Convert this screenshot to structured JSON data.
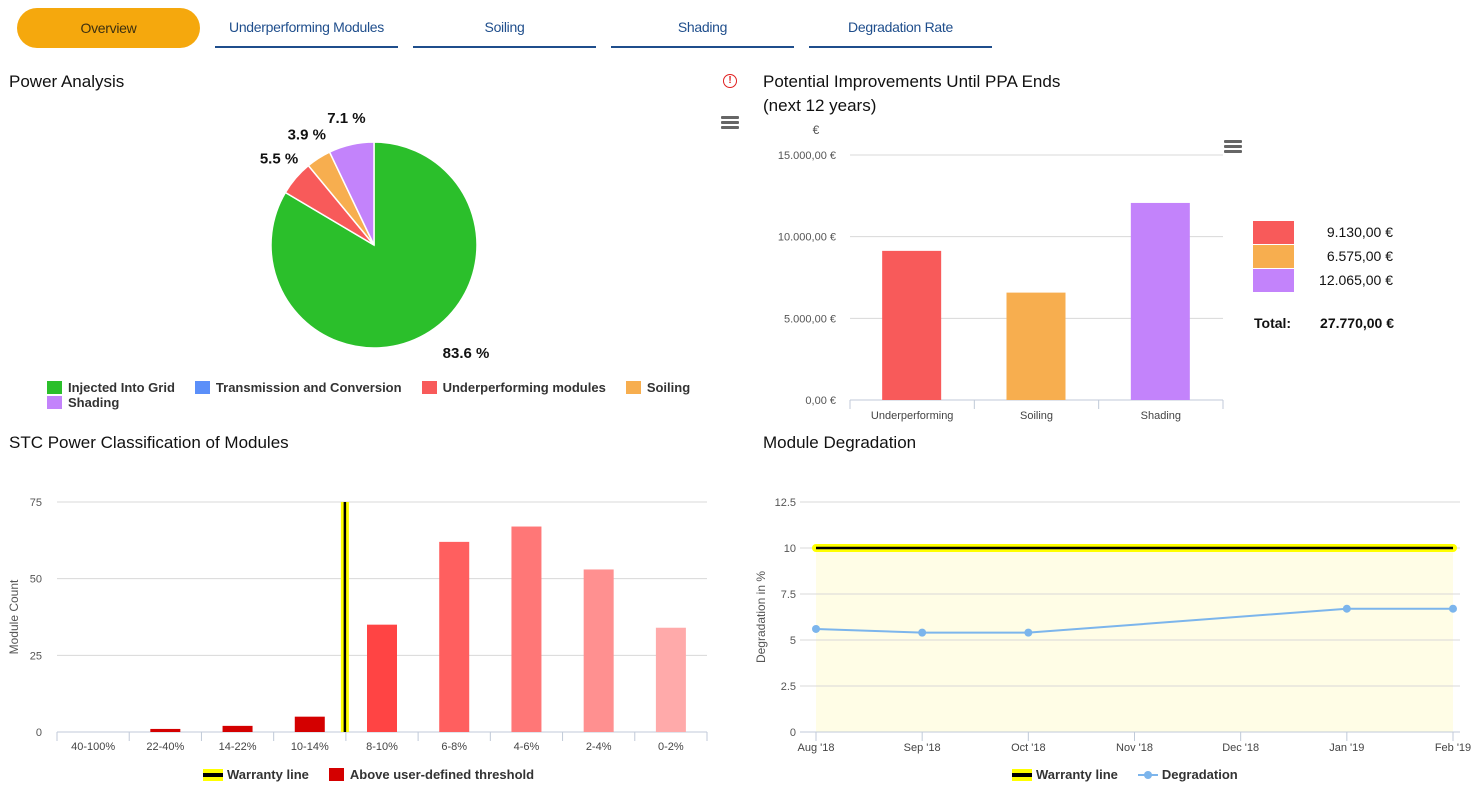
{
  "tabs": [
    {
      "label": "Overview",
      "active": true
    },
    {
      "label": "Underperforming Modules",
      "active": false
    },
    {
      "label": "Soiling",
      "active": false
    },
    {
      "label": "Shading",
      "active": false
    },
    {
      "label": "Degradation Rate",
      "active": false
    }
  ],
  "panels": {
    "power_analysis": {
      "title": "Power Analysis"
    },
    "improvements": {
      "title_line1": "Potential Improvements Until PPA Ends",
      "title_line2": "(next 12 years)",
      "total_label": "Total:",
      "total_value": "27.770,00 €"
    },
    "stc": {
      "title": "STC Power Classification of Modules"
    },
    "degradation": {
      "title": "Module Degradation"
    }
  },
  "chart_data": [
    {
      "id": "power_analysis",
      "type": "pie",
      "title": "Power Analysis",
      "slices": [
        {
          "label": "Injected Into Grid",
          "value": 83.6,
          "display": "83.6 %",
          "color": "#2bbf2b"
        },
        {
          "label": "Transmission and Conversion",
          "value": 0,
          "display": "",
          "color": "#5b8ff9"
        },
        {
          "label": "Underperforming modules",
          "value": 5.5,
          "display": "5.5 %",
          "color": "#f85a5a"
        },
        {
          "label": "Soiling",
          "value": 3.9,
          "display": "3.9 %",
          "color": "#f7ae4f"
        },
        {
          "label": "Shading",
          "value": 7.1,
          "display": "7.1 %",
          "color": "#c383fb"
        }
      ],
      "legend": "bottom"
    },
    {
      "id": "improvements",
      "type": "bar",
      "title": "Potential Improvements Until PPA Ends (next 12 years)",
      "ylabel": "€",
      "categories": [
        "Underperforming",
        "Soiling",
        "Shading"
      ],
      "values": [
        9130,
        6575,
        12065
      ],
      "value_labels": [
        "9.130,00 €",
        "6.575,00 €",
        "12.065,00 €"
      ],
      "colors": [
        "#f85a5a",
        "#f7ae4f",
        "#c383fb"
      ],
      "ylim": [
        0,
        15000
      ],
      "yticks": [
        0,
        5000,
        10000,
        15000
      ],
      "ytick_labels": [
        "0,00 €",
        "5.000,00 €",
        "10.000,00 €",
        "15.000,00 €"
      ],
      "grid": true
    },
    {
      "id": "stc",
      "type": "bar",
      "title": "STC Power Classification of Modules",
      "ylabel": "Module Count",
      "categories": [
        "40-100%",
        "22-40%",
        "14-22%",
        "10-14%",
        "8-10%",
        "6-8%",
        "4-6%",
        "2-4%",
        "0-2%"
      ],
      "values": [
        0,
        1,
        2,
        5,
        35,
        62,
        67,
        53,
        34
      ],
      "colors": [
        "#d40000",
        "#d40000",
        "#d40000",
        "#d40000",
        "#ff4444",
        "#ff5f5f",
        "#ff7777",
        "#ff9090",
        "#ffaaaa"
      ],
      "ylim": [
        0,
        75
      ],
      "yticks": [
        0,
        25,
        50,
        75
      ],
      "warranty_line_after_index": 3,
      "legend": [
        {
          "label": "Warranty line",
          "type": "warranty"
        },
        {
          "label": "Above user-defined threshold",
          "color": "#d40000"
        }
      ],
      "grid": true
    },
    {
      "id": "degradation",
      "type": "line",
      "title": "Module Degradation",
      "ylabel": "Degradation in %",
      "x": [
        "Aug '18",
        "Sep '18",
        "Oct '18",
        "Nov '18",
        "Dec '18",
        "Jan '19",
        "Feb '19"
      ],
      "x_positions": [
        0,
        1,
        2,
        3,
        4,
        5,
        6
      ],
      "series": [
        {
          "name": "Degradation",
          "color": "#7cb5ec",
          "points": [
            [
              0,
              5.6
            ],
            [
              1,
              5.4
            ],
            [
              2,
              5.4
            ],
            [
              5,
              6.7
            ],
            [
              6,
              6.7
            ]
          ]
        },
        {
          "name": "Warranty line",
          "value": 10
        }
      ],
      "ylim": [
        0,
        12.5
      ],
      "yticks": [
        0,
        2.5,
        5,
        7.5,
        10,
        12.5
      ],
      "ytick_labels": [
        "0",
        "2.5",
        "5",
        "7.5",
        "10",
        "12.5"
      ],
      "band_fill": "#fffde6",
      "legend": "bottom",
      "grid": true
    }
  ]
}
